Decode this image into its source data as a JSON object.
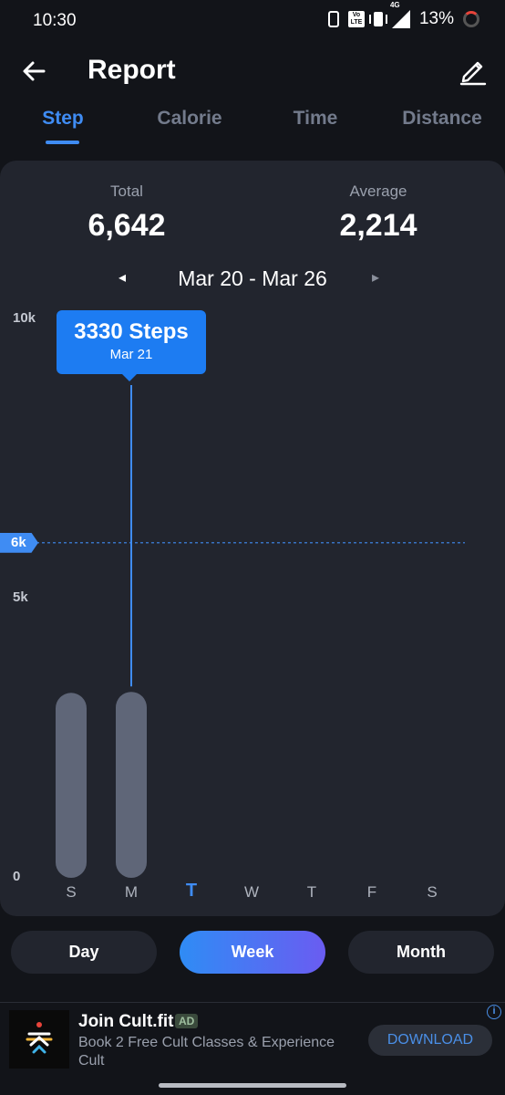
{
  "status_bar": {
    "time": "10:30",
    "volte_label": "Vo LTE",
    "network_label": "4G",
    "battery": "13%",
    "icons": [
      "phone-icon",
      "volte-icon",
      "vibrate-icon",
      "signal-icon",
      "battery-icon"
    ]
  },
  "header": {
    "title": "Report",
    "back_icon": "arrow-left-icon",
    "edit_icon": "pencil-icon"
  },
  "tabs": [
    {
      "label": "Step",
      "active": true
    },
    {
      "label": "Calorie",
      "active": false
    },
    {
      "label": "Time",
      "active": false
    },
    {
      "label": "Distance",
      "active": false
    }
  ],
  "summary": {
    "total_label": "Total",
    "total_value": "6,642",
    "average_label": "Average",
    "average_value": "2,214"
  },
  "date_range": {
    "prev_symbol": "◂",
    "text": "Mar 20 - Mar 26",
    "next_symbol": "▸"
  },
  "tooltip": {
    "value": "3330 Steps",
    "date": "Mar 21"
  },
  "goal_label": "6k",
  "colors": {
    "accent": "#3f8cf3",
    "bar": "#5f6678",
    "card": "#22252e",
    "background": "#121419"
  },
  "chart_data": {
    "type": "bar",
    "categories": [
      "S",
      "M",
      "T",
      "W",
      "T",
      "F",
      "S"
    ],
    "values": [
      3312,
      3330,
      0,
      0,
      0,
      0,
      0
    ],
    "today_index": 2,
    "selected_index": 1,
    "goal": 6000,
    "ylim": [
      0,
      10000
    ],
    "ytick_labels": [
      "10k",
      "5k",
      "0"
    ],
    "yticks": [
      10000,
      5000,
      0
    ],
    "grid": false
  },
  "periods": [
    {
      "label": "Day",
      "active": false
    },
    {
      "label": "Week",
      "active": true
    },
    {
      "label": "Month",
      "active": false
    }
  ],
  "ad": {
    "title": "Join Cult.fit",
    "badge": "AD",
    "description": "Book 2 Free Cult Classes & Experience Cult",
    "cta": "DOWNLOAD",
    "info_symbol": "i"
  }
}
